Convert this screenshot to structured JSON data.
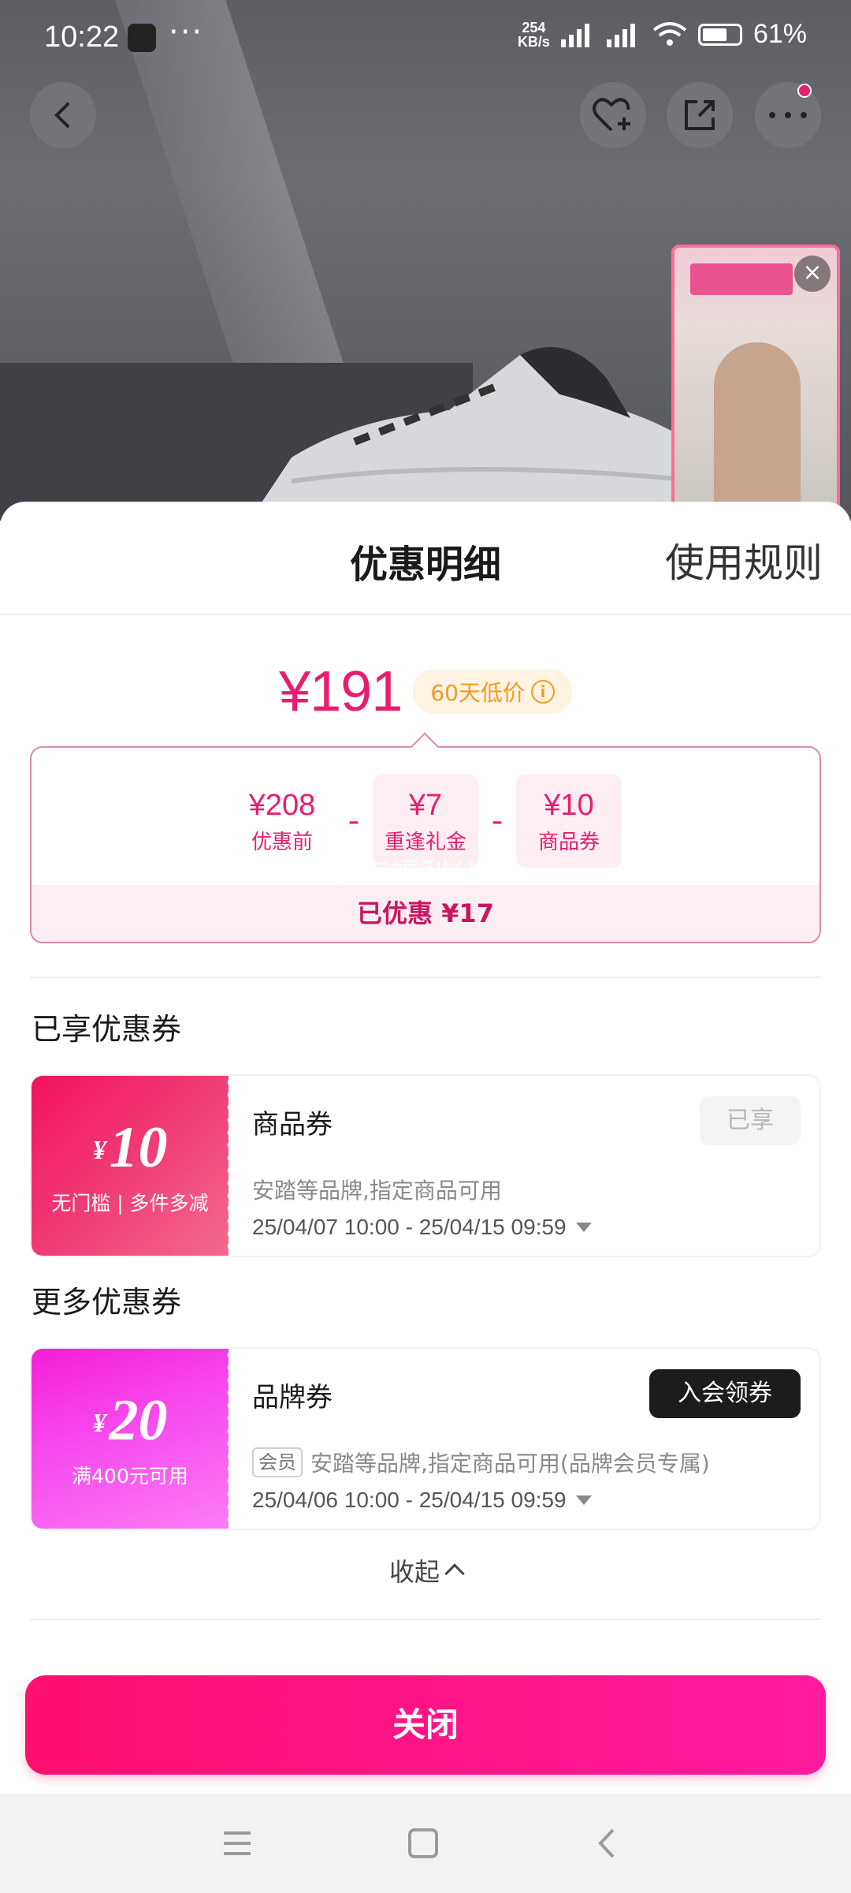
{
  "status_bar": {
    "time": "10:22",
    "more_dots": "···",
    "net_speed_value": "254",
    "net_speed_unit": "KB/s",
    "battery": "61%"
  },
  "header_actions": {
    "back_icon": "chevron-left-icon",
    "favorite_icon": "heart-plus-icon",
    "share_icon": "share-icon",
    "more_icon": "more-dots-icon"
  },
  "live_preview": {
    "close_glyph": "×"
  },
  "sheet": {
    "title": "优惠明细",
    "rules_link": "使用规则"
  },
  "price": {
    "final": "¥191",
    "low_badge": "60天低价",
    "info_glyph": "i"
  },
  "breakdown": {
    "items": [
      {
        "value": "¥208",
        "label": "优惠前"
      },
      {
        "value": "¥7",
        "label": "重逢礼金"
      },
      {
        "value": "¥10",
        "label": "商品券"
      }
    ],
    "operators": [
      "-",
      "-"
    ],
    "saved": "已优惠 ¥17",
    "watermark": "京东福利分享"
  },
  "owned_section": {
    "title": "已享优惠券",
    "coupon": {
      "currency": "¥",
      "amount": "10",
      "condition": "无门槛 | 多件多减",
      "name": "商品券",
      "desc": "安踏等品牌,指定商品可用",
      "date": "25/04/07 10:00 - 25/04/15 09:59",
      "status_button": "已享"
    }
  },
  "more_section": {
    "title": "更多优惠券",
    "coupon": {
      "currency": "¥",
      "amount": "20",
      "condition": "满400元可用",
      "name": "品牌券",
      "tag": "会员",
      "desc": "安踏等品牌,指定商品可用(品牌会员专属)",
      "date": "25/04/06 10:00 - 25/04/15 09:59",
      "action_button": "入会领券"
    }
  },
  "collapse_label": "收起",
  "close_button": "关闭",
  "colors": {
    "brand_pink": "#e81d6f",
    "orange_badge": "#f29b21",
    "close_gradient_start": "#ff0f6e",
    "close_gradient_end": "#ff1aa0"
  }
}
